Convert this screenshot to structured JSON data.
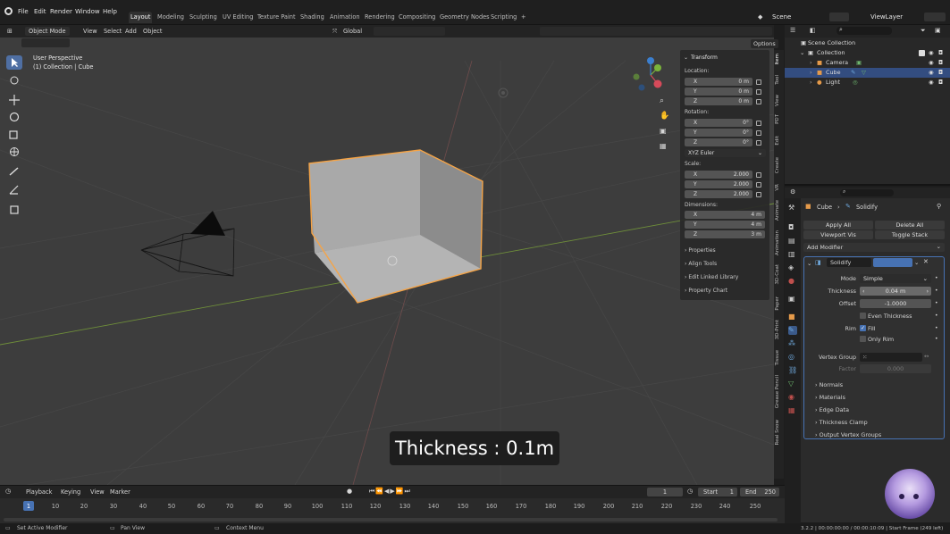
{
  "menus": [
    "File",
    "Edit",
    "Render",
    "Window",
    "Help"
  ],
  "workspaces": [
    "Layout",
    "Modeling",
    "Sculpting",
    "UV Editing",
    "Texture Paint",
    "Shading",
    "Animation",
    "Rendering",
    "Compositing",
    "Geometry Nodes",
    "Scripting"
  ],
  "active_workspace": "Layout",
  "scene_name": "Scene",
  "view_layer": "ViewLayer",
  "viewport": {
    "mode": "Object Mode",
    "menu": [
      "View",
      "Select",
      "Add",
      "Object"
    ],
    "orientation": "Global",
    "options": "Options",
    "info_line1": "User Perspective",
    "info_line2": "(1) Collection | Cube",
    "overlay_text": "Thickness : 0.1m",
    "gizmo_axes": [
      "X",
      "Y",
      "Z"
    ]
  },
  "npanel": {
    "title": "Transform",
    "location_label": "Location:",
    "location": [
      {
        "k": "X",
        "v": "0 m"
      },
      {
        "k": "Y",
        "v": "0 m"
      },
      {
        "k": "Z",
        "v": "0 m"
      }
    ],
    "rotation_label": "Rotation:",
    "rotation": [
      {
        "k": "X",
        "v": "0°"
      },
      {
        "k": "Y",
        "v": "0°"
      },
      {
        "k": "Z",
        "v": "0°"
      }
    ],
    "rotation_mode": "XYZ Euler",
    "scale_label": "Scale:",
    "scale": [
      {
        "k": "X",
        "v": "2.000"
      },
      {
        "k": "Y",
        "v": "2.000"
      },
      {
        "k": "Z",
        "v": "2.000"
      }
    ],
    "dimensions_label": "Dimensions:",
    "dimensions": [
      {
        "k": "X",
        "v": "4 m"
      },
      {
        "k": "Y",
        "v": "4 m"
      },
      {
        "k": "Z",
        "v": "3 m"
      }
    ],
    "sections": [
      "Properties",
      "Align Tools",
      "Edit Linked Library",
      "Property Chart"
    ]
  },
  "side_tabs": [
    "Item",
    "Tool",
    "View",
    "PDT",
    "Edit",
    "Create",
    "VR",
    "Animate",
    "Animation",
    "3D-Coat",
    "Paper",
    "3D-Print",
    "Tissue",
    "Grease Pencil",
    "Real Snow"
  ],
  "outliner": {
    "rows": [
      {
        "label": "Scene Collection",
        "indent": 0
      },
      {
        "label": "Collection",
        "indent": 1
      },
      {
        "label": "Camera",
        "indent": 2
      },
      {
        "label": "Cube",
        "indent": 2
      },
      {
        "label": "Light",
        "indent": 2
      }
    ],
    "selected": "Cube"
  },
  "properties": {
    "breadcrumb_object": "Cube",
    "breadcrumb_modifier": "Solidify",
    "apply_all": "Apply All",
    "delete_all": "Delete All",
    "viewport_vis": "Viewport Vis",
    "toggle_stack": "Toggle Stack",
    "add_modifier": "Add Modifier",
    "modifier_name": "Solidify",
    "mode_label": "Mode",
    "mode_value": "Simple",
    "thickness_label": "Thickness",
    "thickness_value": "0.04 m",
    "offset_label": "Offset",
    "offset_value": "-1.0000",
    "even_thickness": "Even Thickness",
    "rim_label": "Rim",
    "fill": "Fill",
    "only_rim": "Only Rim",
    "vertex_group_label": "Vertex Group",
    "factor_label": "Factor",
    "factor_value": "0.000",
    "subpanels": [
      "Normals",
      "Materials",
      "Edge Data",
      "Thickness Clamp",
      "Output Vertex Groups"
    ]
  },
  "timeline": {
    "menu": [
      "Playback",
      "Keying",
      "View",
      "Marker"
    ],
    "current_frame": "1",
    "start_label": "Start",
    "start": "1",
    "end_label": "End",
    "end": "250",
    "ticks": [
      "1",
      "10",
      "20",
      "30",
      "40",
      "50",
      "60",
      "70",
      "80",
      "90",
      "100",
      "110",
      "120",
      "130",
      "140",
      "150",
      "160",
      "170",
      "180",
      "190",
      "200",
      "210",
      "220",
      "230",
      "240",
      "250"
    ]
  },
  "statusbar": {
    "hint1": "Set Active Modifier",
    "hint2": "Pan View",
    "hint3": "Context Menu",
    "version": "3.2.2 | 00:00:00:00 / 00:00:10:09 | Start Frame (249 left)"
  }
}
